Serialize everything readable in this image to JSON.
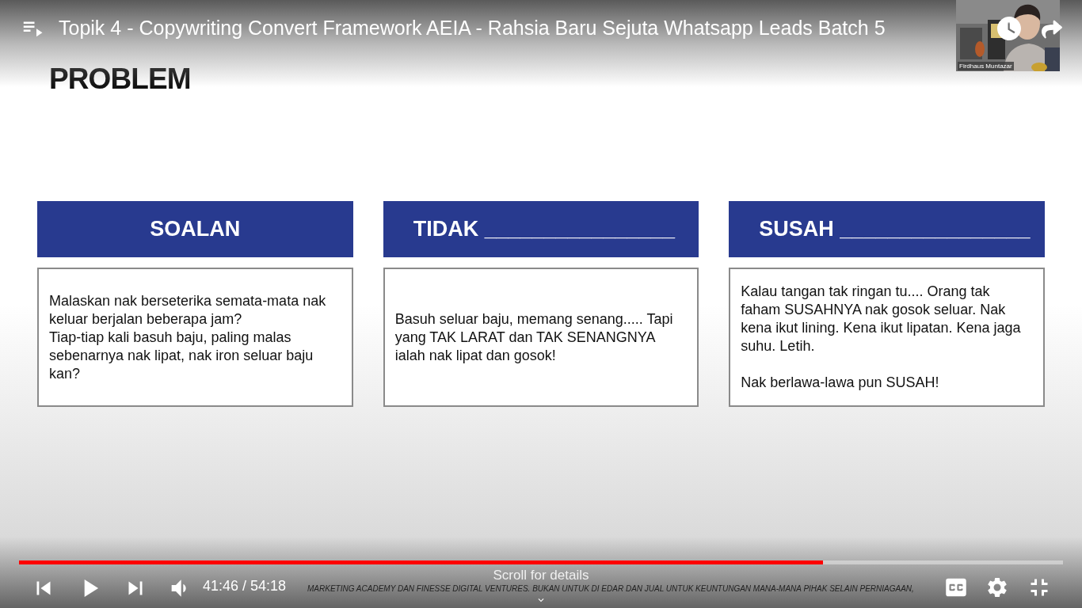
{
  "player": {
    "title": "Topik 4 - Copywriting Convert Framework AEIA - Rahsia Baru Sejuta Whatsapp Leads Batch 5",
    "webcam": {
      "kind": "picture",
      "name": "Firdhaus Muntazar"
    },
    "slide": {
      "heading": "PROBLEM",
      "cards": [
        {
          "title": "SOALAN",
          "kind": "centered",
          "paragraphs": [
            "Malaskan nak berseterika semata-mata nak keluar berjalan beberapa jam?",
            "Tiap-tiap kali basuh baju, paling malas sebenarnya nak lipat, nak iron seluar baju kan?"
          ],
          "spaced": false
        },
        {
          "title": "TIDAK ________________",
          "kind": "fill_in",
          "paragraphs": [
            "Basuh seluar baju, memang senang..... Tapi yang TAK LARAT dan TAK SENANGNYA ialah nak lipat dan gosok!"
          ]
        },
        {
          "title": "SUSAH ________________",
          "kind": "fill_in",
          "paragraphs": [
            "Kalau tangan tak ringan tu.... Orang tak faham SUSAHNYA nak gosok seluar. Nak kena ikut lining. Kena ikut lipatan. Kena jaga suhu. Letih.",
            "Nak berlawa-lawa pun SUSAH!"
          ],
          "spaced": true
        }
      ],
      "footer": "MARKETING ACADEMY  DAN FINESSE DIGITAL VENTURES. BUKAN UNTUK DI EDAR DAN JUAL UNTUK KEUNTUNGAN MANA-MANA PIHAK SELAIN PERNIAGAAN,"
    },
    "progress": {
      "level": 0.77
    },
    "playing": false,
    "time": "41:46 / 54:18",
    "scroll_hint": "Scroll for details"
  }
}
